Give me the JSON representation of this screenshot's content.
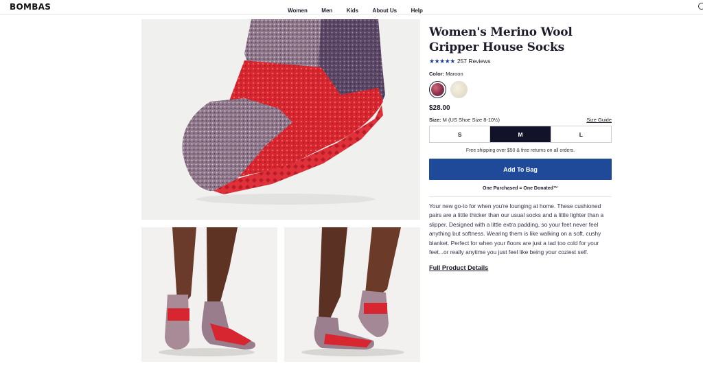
{
  "header": {
    "logo": "BOMBAS",
    "nav": [
      "Women",
      "Men",
      "Kids",
      "About Us",
      "Help"
    ]
  },
  "product": {
    "title": "Women's Merino Wool Gripper House Socks",
    "rating_stars": "★★★★★",
    "reviews": "257 Reviews",
    "color_label": "Color:",
    "color_value": "Maroon",
    "price": "$28.00",
    "size_label": "Size:",
    "size_value": "M (US Shoe Size 8-10½)",
    "size_guide": "Size Guide",
    "sizes": [
      "S",
      "M",
      "L"
    ],
    "selected_size": "M",
    "shipping": "Free shipping over $50 & free returns on all orders.",
    "add_to_bag": "Add To Bag",
    "one_purchased": "One Purchased = One Donated™",
    "description": "Your new go-to for when you're lounging at home. These cushioned pairs are a little thicker than our usual socks and a little lighter than a slipper. Designed with a little extra padding, so your feet never feel anything but softness. Wearing them is like walking on a soft, cushy blanket. Perfect for when your floors are just a tad too cold for your feet...or really anytime you just feel like being your coziest self.",
    "details_link": "Full Product Details"
  },
  "colors": {
    "accent_blue": "#1f4a9a",
    "dark_navy": "#12132b",
    "sock_red": "#d7262f",
    "sock_heather": "#8c7384"
  }
}
